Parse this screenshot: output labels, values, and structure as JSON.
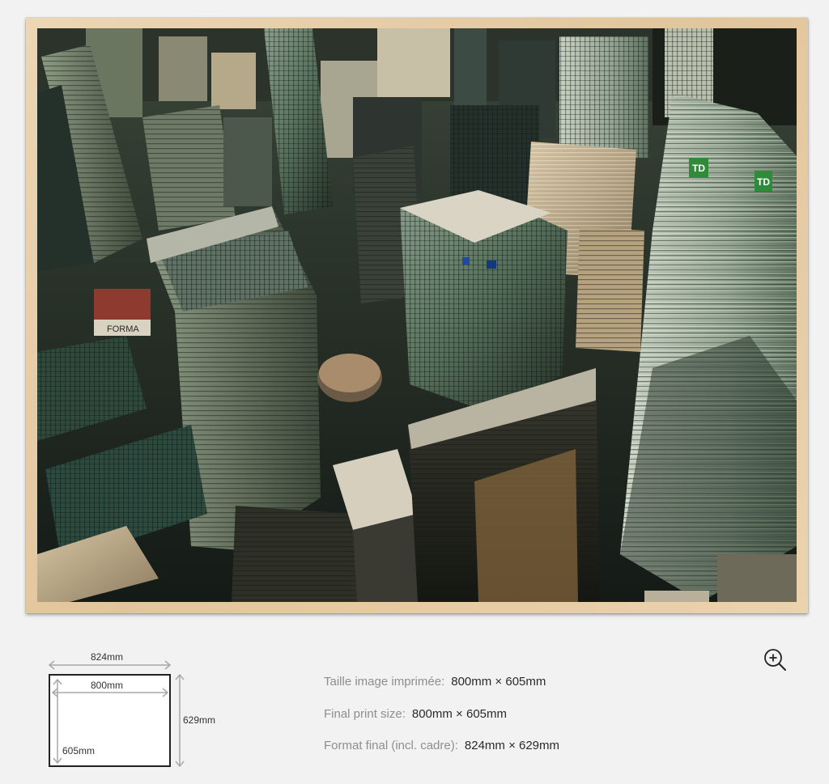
{
  "print": {
    "image_alt": "Aerial view of downtown skyscrapers",
    "tower_logo_text": "TD",
    "rooftop_sign_text": "FORMA"
  },
  "dimensions": {
    "outer_width": "824mm",
    "inner_width": "800mm",
    "outer_height": "629mm",
    "inner_height": "605mm"
  },
  "info": [
    {
      "label": "Taille image imprimée",
      "value": "800mm × 605mm"
    },
    {
      "label": "Final print size",
      "value": "800mm × 605mm"
    },
    {
      "label": "Format final (incl. cadre)",
      "value": "824mm × 629mm"
    }
  ],
  "icons": {
    "zoom": "zoom-in-icon"
  },
  "colors": {
    "frame_wood": "#e2c59c",
    "background": "#f2f2f2",
    "tower_glass": "#6f8872",
    "td_green": "#2f8a3a"
  }
}
